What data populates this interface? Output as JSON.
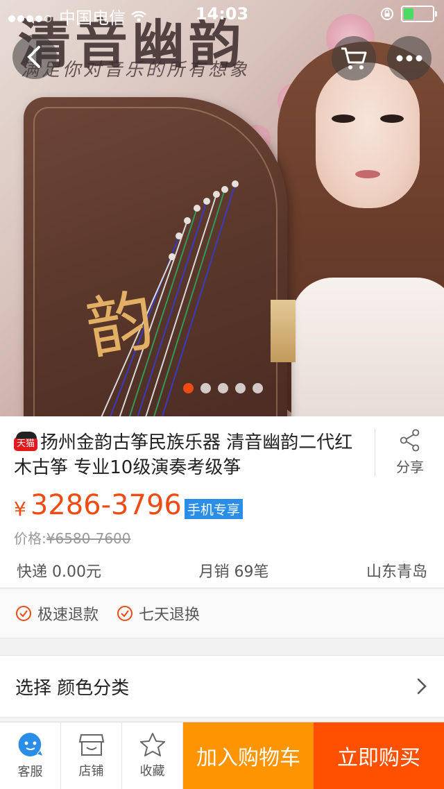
{
  "status_bar": {
    "carrier": "中国电信",
    "time": "14:03"
  },
  "hero": {
    "brand_text": "清音幽韵",
    "slogan": "满足你对音乐的所有想象",
    "calligraphy": "韵",
    "carousel": {
      "count": 5,
      "active_index": 0
    }
  },
  "product": {
    "tmall_badge": "天猫",
    "title": "扬州金韵古筝民族乐器 清音幽韵二代红木古筝 专业10级演奏考级筝",
    "share_label": "分享",
    "currency_symbol": "¥",
    "price_range": "3286-3796",
    "mobile_exclusive_badge": "手机专享",
    "original_price_label": "价格:",
    "original_price": "¥6580-7600",
    "shipping": "快递 0.00元",
    "monthly_sales": "月销 69笔",
    "location": "山东青岛"
  },
  "guarantees": [
    "极速退款",
    "七天退换"
  ],
  "options": {
    "label": "选择 颜色分类"
  },
  "bottom_bar": {
    "service_label": "客服",
    "store_label": "店铺",
    "favorite_label": "收藏",
    "add_to_cart_label": "加入购物车",
    "buy_now_label": "立即购买"
  },
  "colors": {
    "accent_orange": "#ff5000",
    "cart_orange": "#ff9402",
    "price_color": "#f04b12",
    "badge_blue": "#2a8de8"
  }
}
